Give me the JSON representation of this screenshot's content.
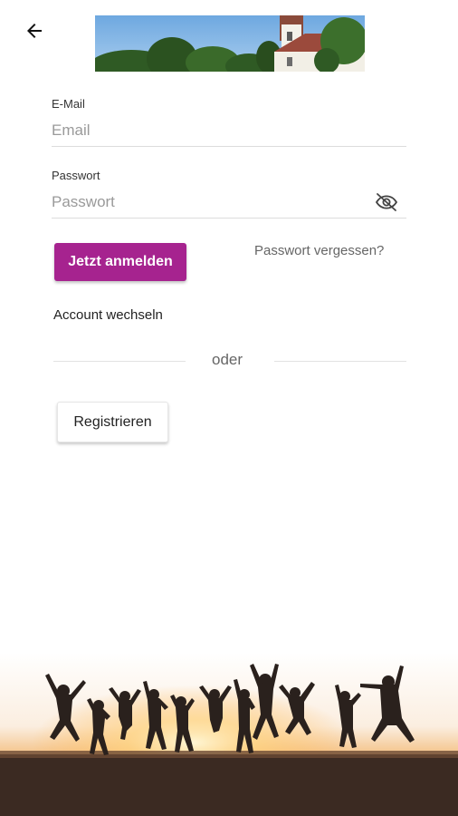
{
  "header": {
    "back_icon": "arrow-left-icon"
  },
  "form": {
    "email_label": "E-Mail",
    "email_placeholder": "Email",
    "email_value": "",
    "password_label": "Passwort",
    "password_placeholder": "Passwort",
    "password_value": "",
    "visibility_icon": "eye-off-icon"
  },
  "actions": {
    "login_label": "Jetzt anmelden",
    "forgot_label": "Passwort vergessen?",
    "switch_account_label": "Account wechseln",
    "or_label": "oder",
    "register_label": "Registrieren"
  },
  "colors": {
    "accent": "#a6238f"
  }
}
